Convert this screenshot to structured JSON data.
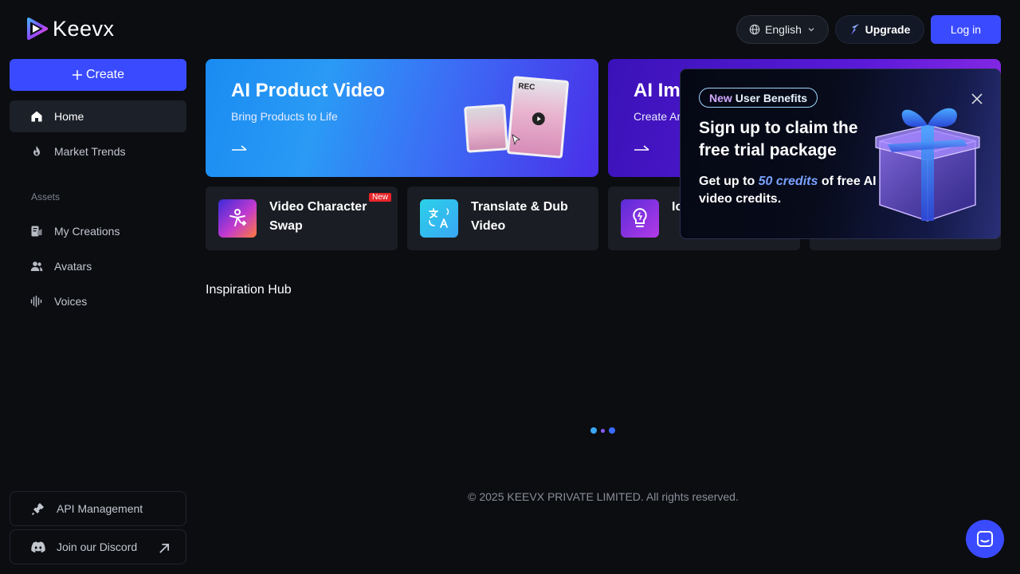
{
  "brand": {
    "name": "Keevx"
  },
  "header": {
    "language": "English",
    "upgrade_label": "Upgrade",
    "login_label": "Log in"
  },
  "sidebar": {
    "create_label": "Create",
    "items": [
      {
        "label": "Home",
        "icon": "home-icon",
        "active": true
      },
      {
        "label": "Market Trends",
        "icon": "flame-icon"
      }
    ],
    "section_label": "Assets",
    "asset_items": [
      {
        "label": "My Creations",
        "icon": "creations-icon"
      },
      {
        "label": "Avatars",
        "icon": "users-icon"
      },
      {
        "label": "Voices",
        "icon": "waveform-icon"
      }
    ],
    "bottom_items": [
      {
        "label": "API Management",
        "icon": "plug-icon"
      },
      {
        "label": "Join our Discord",
        "icon": "discord-icon"
      }
    ]
  },
  "banners": [
    {
      "title": "AI Product Video",
      "subtitle": "Bring Products to Life",
      "rec_label": "REC"
    },
    {
      "title": "AI Im",
      "subtitle": "Create Ar"
    }
  ],
  "tools": [
    {
      "title": "Video Character Swap",
      "badge": "New"
    },
    {
      "title": "Translate & Dub Video"
    },
    {
      "title": "Io"
    }
  ],
  "inspiration": {
    "title": "Inspiration Hub"
  },
  "footer": {
    "copyright": "© 2025 KEEVX PRIVATE LIMITED. All rights reserved."
  },
  "popup": {
    "tag_part1": "New",
    "tag_part2": "User Benefits",
    "title": "Sign up to claim the free trial package",
    "text_before": "Get up to ",
    "credits": "50 credits",
    "text_after": " of free AI video credits."
  },
  "colors": {
    "accent": "#3a4bff",
    "background": "#0b0d11",
    "badge_new": "#e9262b"
  }
}
